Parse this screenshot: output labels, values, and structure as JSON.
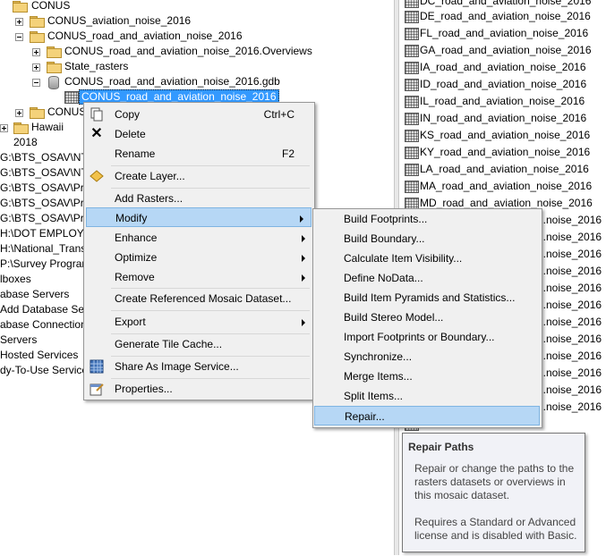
{
  "tree": {
    "items": [
      {
        "label": "CONUS"
      },
      {
        "label": "CONUS_aviation_noise_2016"
      },
      {
        "label": "CONUS_road_and_aviation_noise_2016"
      },
      {
        "label": "CONUS_road_and_aviation_noise_2016.Overviews"
      },
      {
        "label": "State_rasters"
      },
      {
        "label": "CONUS_road_and_aviation_noise_2016.gdb"
      },
      {
        "label": "CONUS_road_and_aviation_noise_2016"
      },
      {
        "label": "CONUS"
      },
      {
        "label": "Hawaii"
      },
      {
        "label": "2018"
      },
      {
        "label": "G:\\BTS_OSAV\\NTA"
      },
      {
        "label": "G:\\BTS_OSAV\\NTA"
      },
      {
        "label": "G:\\BTS_OSAV\\Proj"
      },
      {
        "label": "G:\\BTS_OSAV\\Proj"
      },
      {
        "label": "G:\\BTS_OSAV\\Proj"
      },
      {
        "label": "H:\\DOT EMPLOYE"
      },
      {
        "label": "H:\\National_Trans"
      },
      {
        "label": "P:\\Survey Program"
      },
      {
        "label": "lboxes"
      },
      {
        "label": "abase Servers"
      },
      {
        "label": "Add Database Serv"
      },
      {
        "label": "abase Connections"
      },
      {
        "label": "Servers"
      },
      {
        "label": "Hosted Services"
      },
      {
        "label": "dy-To-Use Service"
      }
    ]
  },
  "raster_list": {
    "items": [
      {
        "label": "DC_road_and_aviation_noise_2016"
      },
      {
        "label": "DE_road_and_aviation_noise_2016"
      },
      {
        "label": "FL_road_and_aviation_noise_2016"
      },
      {
        "label": "GA_road_and_aviation_noise_2016"
      },
      {
        "label": "IA_road_and_aviation_noise_2016"
      },
      {
        "label": "ID_road_and_aviation_noise_2016"
      },
      {
        "label": "IL_road_and_aviation_noise_2016"
      },
      {
        "label": "IN_road_and_aviation_noise_2016"
      },
      {
        "label": "KS_road_and_aviation_noise_2016"
      },
      {
        "label": "KY_road_and_aviation_noise_2016"
      },
      {
        "label": "LA_road_and_aviation_noise_2016"
      },
      {
        "label": "MA_road_and_aviation_noise_2016"
      },
      {
        "label": "MD_road_and_aviation_noise_2016"
      },
      {
        "label": "...noise_2016"
      },
      {
        "label": "...noise_2016"
      },
      {
        "label": "...noise_2016"
      },
      {
        "label": "...noise_2016"
      },
      {
        "label": "...noise_2016"
      },
      {
        "label": "...noise_2016"
      },
      {
        "label": "...noise_2016"
      },
      {
        "label": "...noise_2016"
      },
      {
        "label": "...noise_2016"
      },
      {
        "label": "...noise_2016"
      },
      {
        "label": "...noise_2016"
      },
      {
        "label": "...noise_2016"
      }
    ]
  },
  "context_menu": {
    "items": [
      {
        "label": "Copy",
        "shortcut": "Ctrl+C"
      },
      {
        "label": "Delete"
      },
      {
        "label": "Rename",
        "shortcut": "F2"
      },
      {
        "label": "Create Layer..."
      },
      {
        "label": "Add Rasters..."
      },
      {
        "label": "Modify"
      },
      {
        "label": "Enhance"
      },
      {
        "label": "Optimize"
      },
      {
        "label": "Remove"
      },
      {
        "label": "Create Referenced Mosaic Dataset..."
      },
      {
        "label": "Export"
      },
      {
        "label": "Generate Tile Cache..."
      },
      {
        "label": "Share As Image Service..."
      },
      {
        "label": "Properties..."
      }
    ]
  },
  "submenu": {
    "items": [
      {
        "label": "Build Footprints..."
      },
      {
        "label": "Build Boundary..."
      },
      {
        "label": "Calculate Item Visibility..."
      },
      {
        "label": "Define NoData..."
      },
      {
        "label": "Build Item Pyramids and Statistics..."
      },
      {
        "label": "Build Stereo Model..."
      },
      {
        "label": "Import Footprints or Boundary..."
      },
      {
        "label": "Synchronize..."
      },
      {
        "label": "Merge Items..."
      },
      {
        "label": "Split Items..."
      },
      {
        "label": "Repair..."
      }
    ]
  },
  "tooltip": {
    "title": "Repair Paths",
    "body1": "Repair or change the paths to the rasters datasets or overviews in this mosaic dataset.",
    "body2": "Requires a Standard or Advanced license and is disabled with Basic."
  },
  "icons": {
    "copy": "copy-icon",
    "delete": "delete-icon",
    "layer": "layer-icon",
    "share": "share-icon",
    "properties": "properties-icon"
  }
}
